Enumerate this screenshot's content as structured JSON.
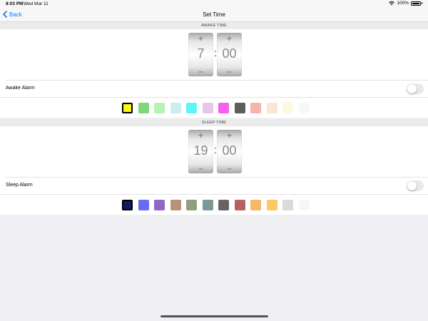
{
  "status_bar": {
    "time": "8:03 PM",
    "date": "Wed Mar 11",
    "battery": "100%",
    "wifi_icon": "wifi-icon"
  },
  "nav": {
    "back_label": "Back",
    "title": "Set Time"
  },
  "awake": {
    "header": "AWAKE TIME",
    "hour": "7",
    "minute": "00",
    "plus": "+",
    "minus": "–",
    "colon": ":",
    "alarm_label": "Awake Alarm",
    "alarm_on": false,
    "colors": [
      "#fafa18",
      "#7dd77a",
      "#b5f2b3",
      "#cdeef0",
      "#5ff5f8",
      "#e6c7ea",
      "#f75ff2",
      "#5d5d5d",
      "#f6b4aa",
      "#fbe6d4",
      "#fdf9de",
      "#f7f7f7"
    ],
    "selected_index": 0
  },
  "sleep": {
    "header": "SLEEP TIME",
    "hour": "19",
    "minute": "00",
    "plus": "+",
    "minus": "–",
    "colon": ":",
    "alarm_label": "Sleep Alarm",
    "alarm_on": false,
    "colors": [
      "#141a62",
      "#6b6bf2",
      "#9466c4",
      "#b99177",
      "#8f9e7c",
      "#7c9897",
      "#646464",
      "#b86162",
      "#f7b766",
      "#fcc865",
      "#dadada",
      "#f7f7f7"
    ],
    "selected_index": 0
  }
}
